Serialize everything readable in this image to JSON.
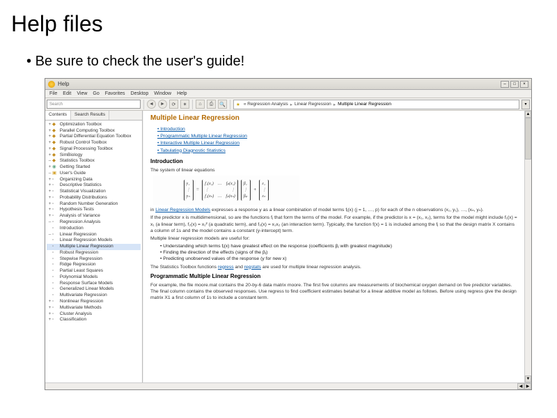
{
  "slide": {
    "title": "Help files",
    "bullet": "Be sure to check the user's guide!"
  },
  "window": {
    "title": "Help",
    "controls": {
      "min": "–",
      "max": "□",
      "close": "×"
    },
    "menubar": [
      "File",
      "Edit",
      "View",
      "Go",
      "Favorites",
      "Desktop",
      "Window",
      "Help"
    ],
    "toolbar": {
      "search_placeholder": "Search",
      "back": "◄",
      "fwd": "►",
      "reload": "⟳",
      "gear": "✶",
      "home": "⌂",
      "print": "⎙",
      "find": "🔍",
      "dd": "▾"
    },
    "breadcrumb": {
      "star": "★",
      "items": [
        "« Regression Analysis",
        "Linear Regression",
        "Multiple Linear Regression"
      ]
    }
  },
  "sidebar": {
    "tabs": [
      "Contents",
      "Search Results"
    ],
    "tree": [
      {
        "lvl": 0,
        "exp": "+",
        "ico": "pkg",
        "label": "Optimization Toolbox"
      },
      {
        "lvl": 0,
        "exp": "+",
        "ico": "pkg",
        "label": "Parallel Computing Toolbox"
      },
      {
        "lvl": 0,
        "exp": "+",
        "ico": "pkg",
        "label": "Partial Differential Equation Toolbox"
      },
      {
        "lvl": 0,
        "exp": "+",
        "ico": "pkg",
        "label": "Robust Control Toolbox"
      },
      {
        "lvl": 0,
        "exp": "+",
        "ico": "pkg",
        "label": "Signal Processing Toolbox"
      },
      {
        "lvl": 0,
        "exp": "+",
        "ico": "pkg",
        "label": "SimBiology"
      },
      {
        "lvl": 0,
        "exp": "–",
        "ico": "pkg",
        "label": "Statistics Toolbox"
      },
      {
        "lvl": 1,
        "exp": "+",
        "ico": "cube",
        "label": "Getting Started"
      },
      {
        "lvl": 1,
        "exp": "–",
        "ico": "book",
        "label": "User's Guide"
      },
      {
        "lvl": 2,
        "exp": "+",
        "ico": "page",
        "label": "Organizing Data"
      },
      {
        "lvl": 2,
        "exp": "+",
        "ico": "page",
        "label": "Descriptive Statistics"
      },
      {
        "lvl": 2,
        "exp": "+",
        "ico": "page",
        "label": "Statistical Visualization"
      },
      {
        "lvl": 2,
        "exp": "+",
        "ico": "page",
        "label": "Probability Distributions"
      },
      {
        "lvl": 2,
        "exp": "+",
        "ico": "page",
        "label": "Random Number Generation"
      },
      {
        "lvl": 2,
        "exp": "+",
        "ico": "page",
        "label": "Hypothesis Tests"
      },
      {
        "lvl": 2,
        "exp": "+",
        "ico": "page",
        "label": "Analysis of Variance"
      },
      {
        "lvl": 2,
        "exp": "–",
        "ico": "page",
        "label": "Regression Analysis"
      },
      {
        "lvl": 3,
        "exp": " ",
        "ico": "page",
        "label": "Introduction"
      },
      {
        "lvl": 3,
        "exp": "–",
        "ico": "page",
        "label": "Linear Regression"
      },
      {
        "lvl": 3,
        "exp": " ",
        "ico": "page",
        "label": "Linear Regression Models"
      },
      {
        "lvl": 3,
        "exp": " ",
        "ico": "page",
        "label": "Multiple Linear Regression",
        "sel": true
      },
      {
        "lvl": 3,
        "exp": " ",
        "ico": "page",
        "label": "Robust Regression"
      },
      {
        "lvl": 3,
        "exp": " ",
        "ico": "page",
        "label": "Stepwise Regression"
      },
      {
        "lvl": 3,
        "exp": " ",
        "ico": "page",
        "label": "Ridge Regression"
      },
      {
        "lvl": 3,
        "exp": " ",
        "ico": "page",
        "label": "Partial Least Squares"
      },
      {
        "lvl": 3,
        "exp": " ",
        "ico": "page",
        "label": "Polynomial Models"
      },
      {
        "lvl": 3,
        "exp": " ",
        "ico": "page",
        "label": "Response Surface Models"
      },
      {
        "lvl": 3,
        "exp": " ",
        "ico": "page",
        "label": "Generalized Linear Models"
      },
      {
        "lvl": 3,
        "exp": " ",
        "ico": "page",
        "label": "Multivariate Regression"
      },
      {
        "lvl": 2,
        "exp": "+",
        "ico": "page",
        "label": "Nonlinear Regression"
      },
      {
        "lvl": 2,
        "exp": "+",
        "ico": "page",
        "label": "Multivariate Methods"
      },
      {
        "lvl": 2,
        "exp": "+",
        "ico": "page",
        "label": "Cluster Analysis"
      },
      {
        "lvl": 2,
        "exp": "+",
        "ico": "page",
        "label": "Classification"
      }
    ]
  },
  "doc": {
    "title": "Multiple Linear Regression",
    "toc": [
      "Introduction",
      "Programmatic Multiple Linear Regression",
      "Interactive Multiple Linear Regression",
      "Tabulating Diagnostic Statistics"
    ],
    "h_intro": "Introduction",
    "p_intro": "The system of linear equations",
    "eq_left_rows": [
      "y₁",
      "⋮",
      "yₙ"
    ],
    "eq_mat": [
      [
        "f₁(x₁)",
        "…",
        "fₚ(x₁)"
      ],
      [
        "⋮",
        " ",
        "⋮"
      ],
      [
        "f₁(xₙ)",
        "…",
        "fₚ(xₙ)"
      ]
    ],
    "eq_beta": [
      "β₁",
      "⋮",
      "βₚ"
    ],
    "eq_eps": [
      "ε₁",
      "⋮",
      "εₙ"
    ],
    "p_after_eq1": "in Linear Regression Models expresses a response y as a linear combination of model terms fⱼ(x) (j = 1, …, p) for each of the n observations (x₁, y₁), …, (xₙ, yₙ).",
    "p_after_eq2": "If the predictor x is multidimensional, so are the functions fⱼ that form the terms of the model. For example, if the predictor is x = (x₁, x₂), terms for the model might include f₁(x) = x₁ (a linear term), f₂(x) = x₁² (a quadratic term), and f₃(x) = x₁x₂ (an interaction term). Typically, the function f(x) = 1 is included among the fⱼ so that the design matrix X contains a column of 1s and the model contains a constant (y-intercept) term.",
    "p_useful": "Multiple linear regression models are useful for:",
    "ul_useful": [
      "Understanding which terms fⱼ(x) have greatest effect on the response (coefficients βⱼ with greatest magnitude)",
      "Finding the direction of the effects (signs of the βⱼ)",
      "Predicting unobserved values of the response (y for new x)"
    ],
    "p_funcs_a": "The Statistics Toolbox functions ",
    "p_funcs_link1": "regress",
    "p_funcs_mid": " and ",
    "p_funcs_link2": "regstats",
    "p_funcs_b": " are used for multiple linear regression analysis.",
    "h_prog": "Programmatic Multiple Linear Regression",
    "p_prog": "For example, the file moore.mat contains the 20-by-6 data matrix moore. The first five columns are measurements of biochemical oxygen demand on five predictor variables. The final column contains the observed responses. Use regress to find coefficient estimates betahat for a linear additive model as follows. Before using regress give the design matrix X1 a first column of 1s to include a constant term."
  }
}
